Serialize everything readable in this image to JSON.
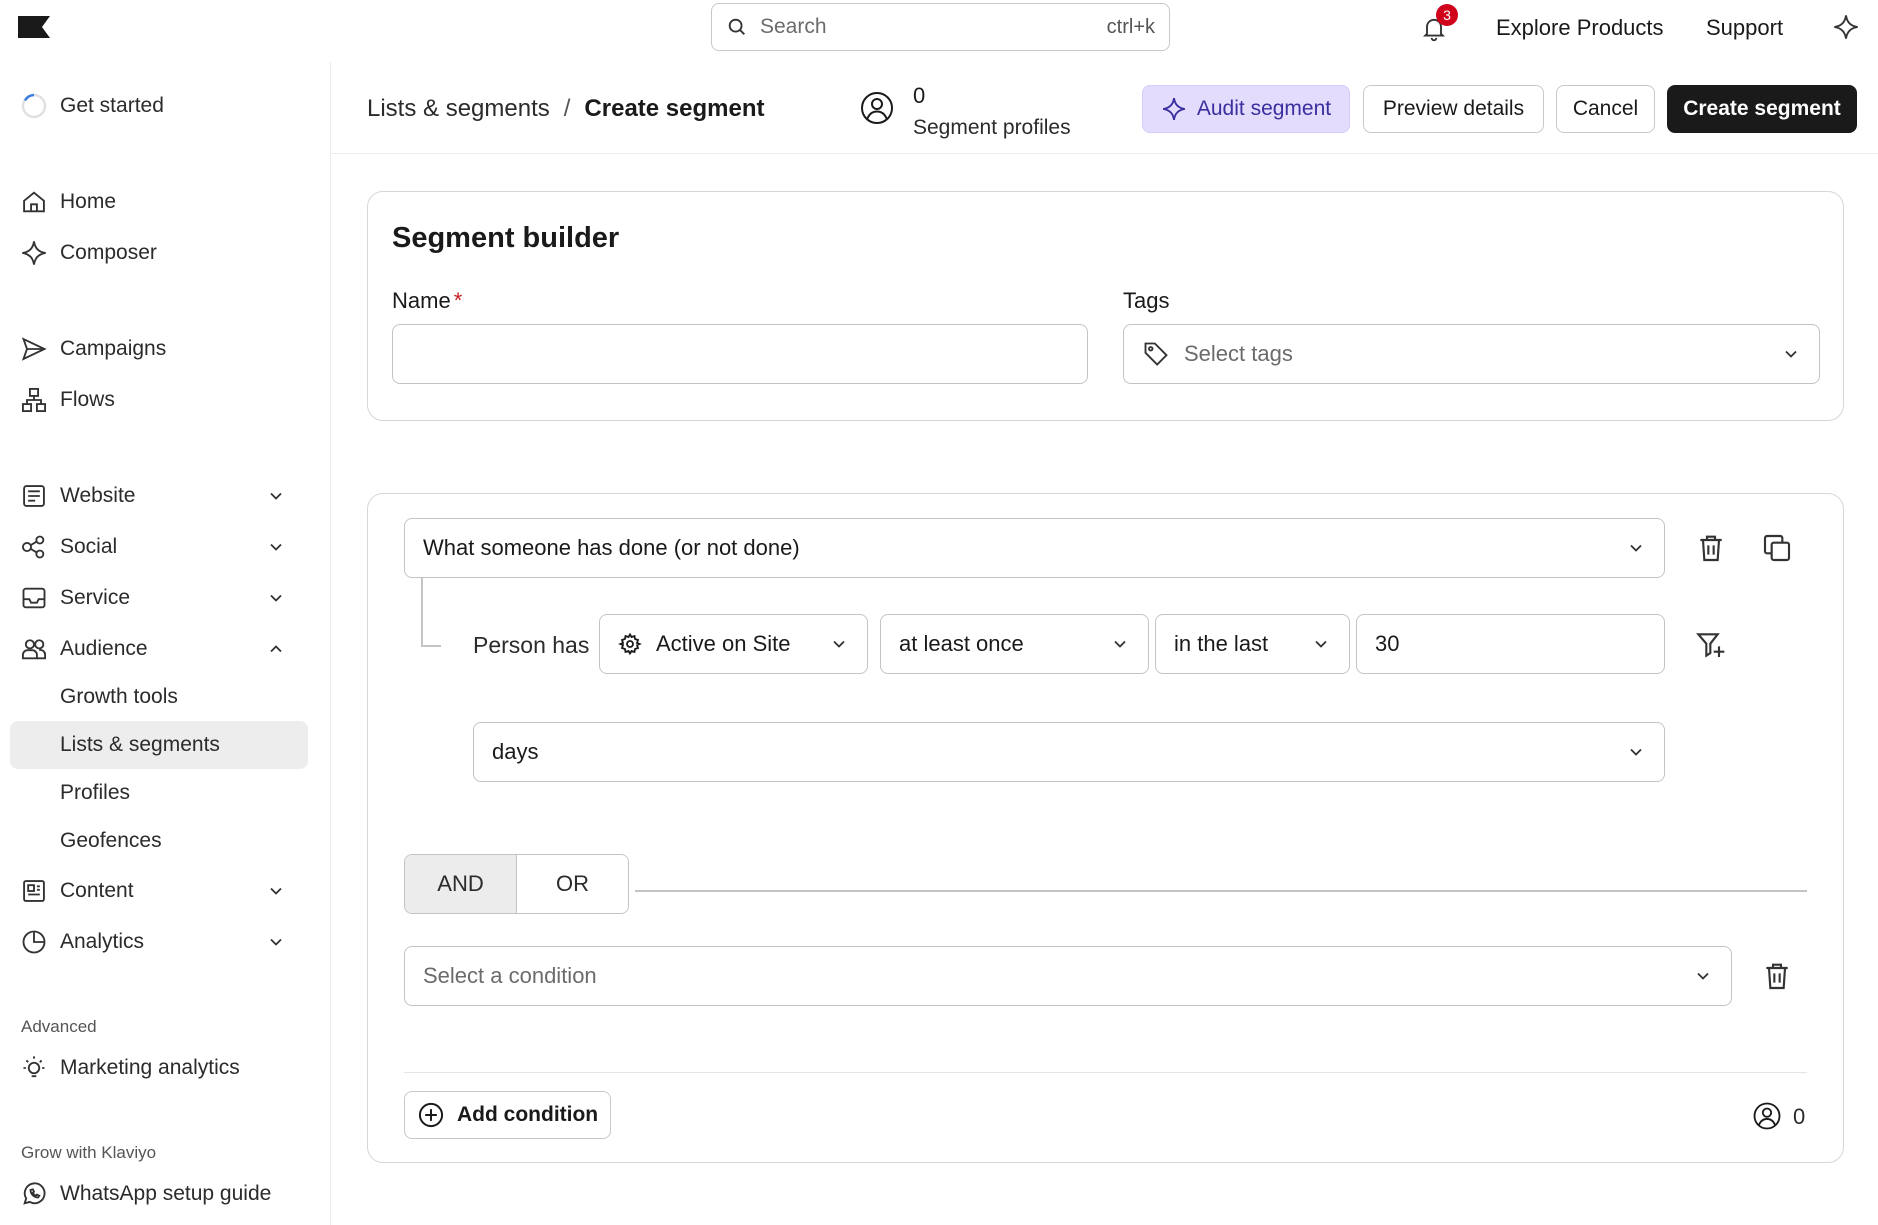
{
  "topbar": {
    "search_placeholder": "Search",
    "search_shortcut": "ctrl+k",
    "notification_count": "3",
    "explore_label": "Explore Products",
    "support_label": "Support"
  },
  "sidebar": {
    "get_started": "Get started",
    "items": {
      "home": "Home",
      "composer": "Composer",
      "campaigns": "Campaigns",
      "flows": "Flows",
      "website": "Website",
      "social": "Social",
      "service": "Service",
      "audience": "Audience",
      "growth_tools": "Growth tools",
      "lists_segments": "Lists & segments",
      "profiles": "Profiles",
      "geofences": "Geofences",
      "content": "Content",
      "analytics": "Analytics",
      "marketing_analytics": "Marketing analytics",
      "whatsapp_guide": "WhatsApp setup guide"
    },
    "section_advanced": "Advanced",
    "section_grow": "Grow with Klaviyo"
  },
  "header": {
    "breadcrumb_parent": "Lists & segments",
    "breadcrumb_sep": "/",
    "breadcrumb_current": "Create segment",
    "profiles_count": "0",
    "profiles_label": "Segment profiles",
    "audit_label": "Audit segment",
    "preview_label": "Preview details",
    "cancel_label": "Cancel",
    "create_label": "Create segment"
  },
  "builder": {
    "title": "Segment builder",
    "name_label": "Name",
    "name_required": "*",
    "name_value": "",
    "tags_label": "Tags",
    "tags_placeholder": "Select tags"
  },
  "conditions": {
    "type_select": "What someone has done (or not done)",
    "person_has": "Person has",
    "metric": "Active on Site",
    "frequency": "at least once",
    "timeframe": "in the last",
    "amount": "30",
    "unit": "days",
    "and_label": "AND",
    "or_label": "OR",
    "condition_placeholder": "Select a condition",
    "add_condition": "Add condition",
    "footer_count": "0"
  },
  "colors": {
    "audit_bg": "#e3dcfd",
    "create_bg": "#1a1a1a",
    "badge": "#d0021b",
    "active_nav": "#ededed"
  }
}
